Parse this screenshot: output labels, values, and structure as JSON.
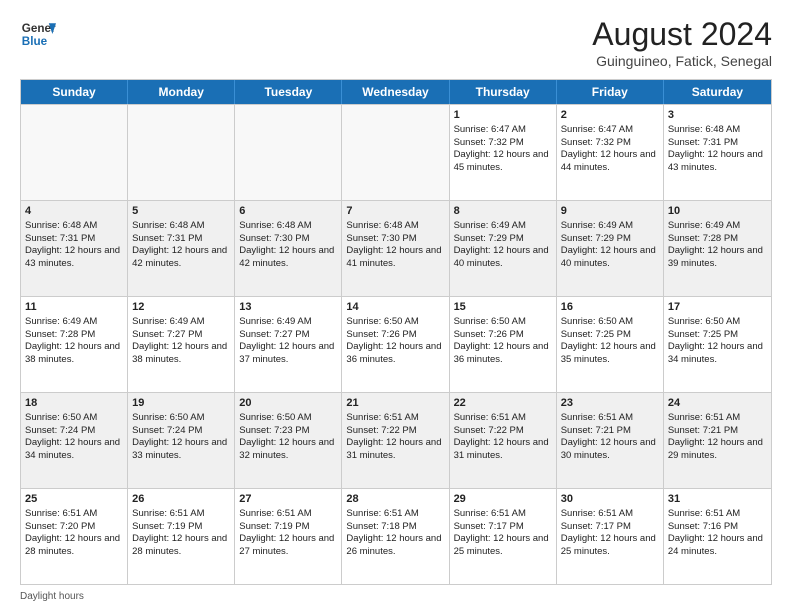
{
  "header": {
    "logo_general": "General",
    "logo_blue": "Blue",
    "month_title": "August 2024",
    "subtitle": "Guinguineo, Fatick, Senegal"
  },
  "days_of_week": [
    "Sunday",
    "Monday",
    "Tuesday",
    "Wednesday",
    "Thursday",
    "Friday",
    "Saturday"
  ],
  "footer": {
    "daylight_label": "Daylight hours"
  },
  "weeks": [
    [
      {
        "day": "",
        "sunrise": "",
        "sunset": "",
        "daylight": ""
      },
      {
        "day": "",
        "sunrise": "",
        "sunset": "",
        "daylight": ""
      },
      {
        "day": "",
        "sunrise": "",
        "sunset": "",
        "daylight": ""
      },
      {
        "day": "",
        "sunrise": "",
        "sunset": "",
        "daylight": ""
      },
      {
        "day": "1",
        "sunrise": "Sunrise: 6:47 AM",
        "sunset": "Sunset: 7:32 PM",
        "daylight": "Daylight: 12 hours and 45 minutes."
      },
      {
        "day": "2",
        "sunrise": "Sunrise: 6:47 AM",
        "sunset": "Sunset: 7:32 PM",
        "daylight": "Daylight: 12 hours and 44 minutes."
      },
      {
        "day": "3",
        "sunrise": "Sunrise: 6:48 AM",
        "sunset": "Sunset: 7:31 PM",
        "daylight": "Daylight: 12 hours and 43 minutes."
      }
    ],
    [
      {
        "day": "4",
        "sunrise": "Sunrise: 6:48 AM",
        "sunset": "Sunset: 7:31 PM",
        "daylight": "Daylight: 12 hours and 43 minutes."
      },
      {
        "day": "5",
        "sunrise": "Sunrise: 6:48 AM",
        "sunset": "Sunset: 7:31 PM",
        "daylight": "Daylight: 12 hours and 42 minutes."
      },
      {
        "day": "6",
        "sunrise": "Sunrise: 6:48 AM",
        "sunset": "Sunset: 7:30 PM",
        "daylight": "Daylight: 12 hours and 42 minutes."
      },
      {
        "day": "7",
        "sunrise": "Sunrise: 6:48 AM",
        "sunset": "Sunset: 7:30 PM",
        "daylight": "Daylight: 12 hours and 41 minutes."
      },
      {
        "day": "8",
        "sunrise": "Sunrise: 6:49 AM",
        "sunset": "Sunset: 7:29 PM",
        "daylight": "Daylight: 12 hours and 40 minutes."
      },
      {
        "day": "9",
        "sunrise": "Sunrise: 6:49 AM",
        "sunset": "Sunset: 7:29 PM",
        "daylight": "Daylight: 12 hours and 40 minutes."
      },
      {
        "day": "10",
        "sunrise": "Sunrise: 6:49 AM",
        "sunset": "Sunset: 7:28 PM",
        "daylight": "Daylight: 12 hours and 39 minutes."
      }
    ],
    [
      {
        "day": "11",
        "sunrise": "Sunrise: 6:49 AM",
        "sunset": "Sunset: 7:28 PM",
        "daylight": "Daylight: 12 hours and 38 minutes."
      },
      {
        "day": "12",
        "sunrise": "Sunrise: 6:49 AM",
        "sunset": "Sunset: 7:27 PM",
        "daylight": "Daylight: 12 hours and 38 minutes."
      },
      {
        "day": "13",
        "sunrise": "Sunrise: 6:49 AM",
        "sunset": "Sunset: 7:27 PM",
        "daylight": "Daylight: 12 hours and 37 minutes."
      },
      {
        "day": "14",
        "sunrise": "Sunrise: 6:50 AM",
        "sunset": "Sunset: 7:26 PM",
        "daylight": "Daylight: 12 hours and 36 minutes."
      },
      {
        "day": "15",
        "sunrise": "Sunrise: 6:50 AM",
        "sunset": "Sunset: 7:26 PM",
        "daylight": "Daylight: 12 hours and 36 minutes."
      },
      {
        "day": "16",
        "sunrise": "Sunrise: 6:50 AM",
        "sunset": "Sunset: 7:25 PM",
        "daylight": "Daylight: 12 hours and 35 minutes."
      },
      {
        "day": "17",
        "sunrise": "Sunrise: 6:50 AM",
        "sunset": "Sunset: 7:25 PM",
        "daylight": "Daylight: 12 hours and 34 minutes."
      }
    ],
    [
      {
        "day": "18",
        "sunrise": "Sunrise: 6:50 AM",
        "sunset": "Sunset: 7:24 PM",
        "daylight": "Daylight: 12 hours and 34 minutes."
      },
      {
        "day": "19",
        "sunrise": "Sunrise: 6:50 AM",
        "sunset": "Sunset: 7:24 PM",
        "daylight": "Daylight: 12 hours and 33 minutes."
      },
      {
        "day": "20",
        "sunrise": "Sunrise: 6:50 AM",
        "sunset": "Sunset: 7:23 PM",
        "daylight": "Daylight: 12 hours and 32 minutes."
      },
      {
        "day": "21",
        "sunrise": "Sunrise: 6:51 AM",
        "sunset": "Sunset: 7:22 PM",
        "daylight": "Daylight: 12 hours and 31 minutes."
      },
      {
        "day": "22",
        "sunrise": "Sunrise: 6:51 AM",
        "sunset": "Sunset: 7:22 PM",
        "daylight": "Daylight: 12 hours and 31 minutes."
      },
      {
        "day": "23",
        "sunrise": "Sunrise: 6:51 AM",
        "sunset": "Sunset: 7:21 PM",
        "daylight": "Daylight: 12 hours and 30 minutes."
      },
      {
        "day": "24",
        "sunrise": "Sunrise: 6:51 AM",
        "sunset": "Sunset: 7:21 PM",
        "daylight": "Daylight: 12 hours and 29 minutes."
      }
    ],
    [
      {
        "day": "25",
        "sunrise": "Sunrise: 6:51 AM",
        "sunset": "Sunset: 7:20 PM",
        "daylight": "Daylight: 12 hours and 28 minutes."
      },
      {
        "day": "26",
        "sunrise": "Sunrise: 6:51 AM",
        "sunset": "Sunset: 7:19 PM",
        "daylight": "Daylight: 12 hours and 28 minutes."
      },
      {
        "day": "27",
        "sunrise": "Sunrise: 6:51 AM",
        "sunset": "Sunset: 7:19 PM",
        "daylight": "Daylight: 12 hours and 27 minutes."
      },
      {
        "day": "28",
        "sunrise": "Sunrise: 6:51 AM",
        "sunset": "Sunset: 7:18 PM",
        "daylight": "Daylight: 12 hours and 26 minutes."
      },
      {
        "day": "29",
        "sunrise": "Sunrise: 6:51 AM",
        "sunset": "Sunset: 7:17 PM",
        "daylight": "Daylight: 12 hours and 25 minutes."
      },
      {
        "day": "30",
        "sunrise": "Sunrise: 6:51 AM",
        "sunset": "Sunset: 7:17 PM",
        "daylight": "Daylight: 12 hours and 25 minutes."
      },
      {
        "day": "31",
        "sunrise": "Sunrise: 6:51 AM",
        "sunset": "Sunset: 7:16 PM",
        "daylight": "Daylight: 12 hours and 24 minutes."
      }
    ]
  ]
}
